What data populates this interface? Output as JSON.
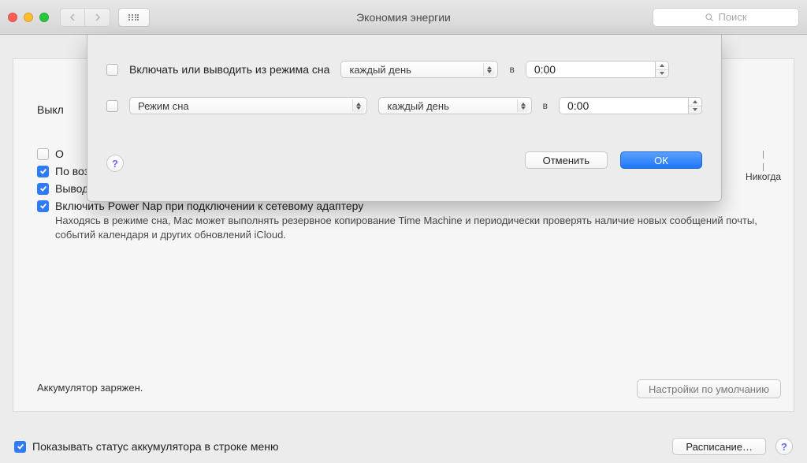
{
  "titlebar": {
    "title": "Экономия энергии",
    "search_placeholder": "Поиск"
  },
  "pane": {
    "bg_label_trunc": "Выкл",
    "never_label": "Никогда",
    "opt0_trunc": "О",
    "opt1": "По возможности переводить диски в режим сна",
    "opt2": "Выводить из режима сна для доступа по сети Wi-Fi",
    "opt3": "Включить Power Nap при подключении к сетевому адаптеру",
    "opt3_desc": "Находясь в режиме сна, Mac может выполнять резервное копирование Time Machine и периодически проверять наличие новых сообщений почты, событий календаря и других обновлений iCloud.",
    "battery_status": "Аккумулятор заряжен.",
    "defaults_btn": "Настройки по умолчанию"
  },
  "footer": {
    "show_status": "Показывать статус аккумулятора в строке меню",
    "schedule_btn": "Расписание…"
  },
  "sheet": {
    "row1_label": "Включать или выводить из режима сна",
    "row1_freq": "каждый день",
    "at": "в",
    "row1_time": "0:00",
    "row2_label": "Режим сна",
    "row2_freq": "каждый день",
    "row2_time": "0:00",
    "cancel": "Отменить",
    "ok": "ОК"
  }
}
